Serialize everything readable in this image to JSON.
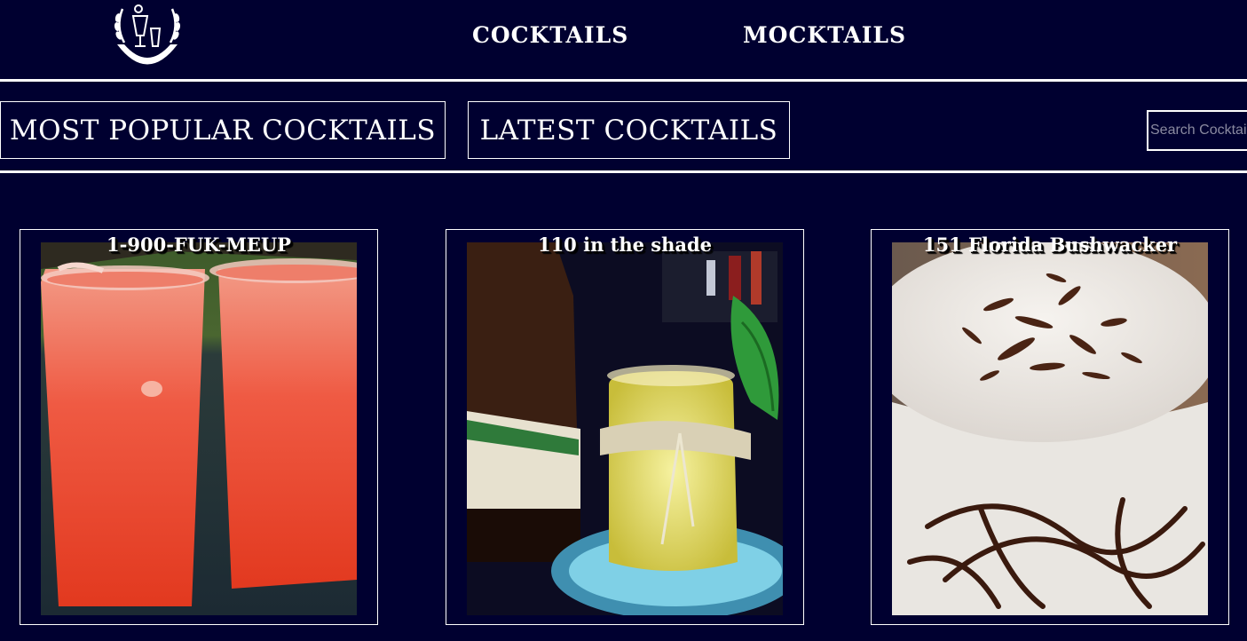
{
  "nav": {
    "logo_icon": "cocktail-wreath-logo",
    "links": [
      {
        "label": "COCKTAILS"
      },
      {
        "label": "MOCKTAILS"
      }
    ]
  },
  "subnav": {
    "popular_label": "MOST POPULAR COCKTAILS",
    "latest_label": "LATEST COCKTAILS",
    "search_placeholder": "Search Cocktails"
  },
  "cards": [
    {
      "title": "1-900-FUK-MEUP"
    },
    {
      "title": "110 in the shade"
    },
    {
      "title": "151 Florida Bushwacker"
    }
  ],
  "colors": {
    "background": "#000030",
    "foreground": "#ffffff"
  }
}
